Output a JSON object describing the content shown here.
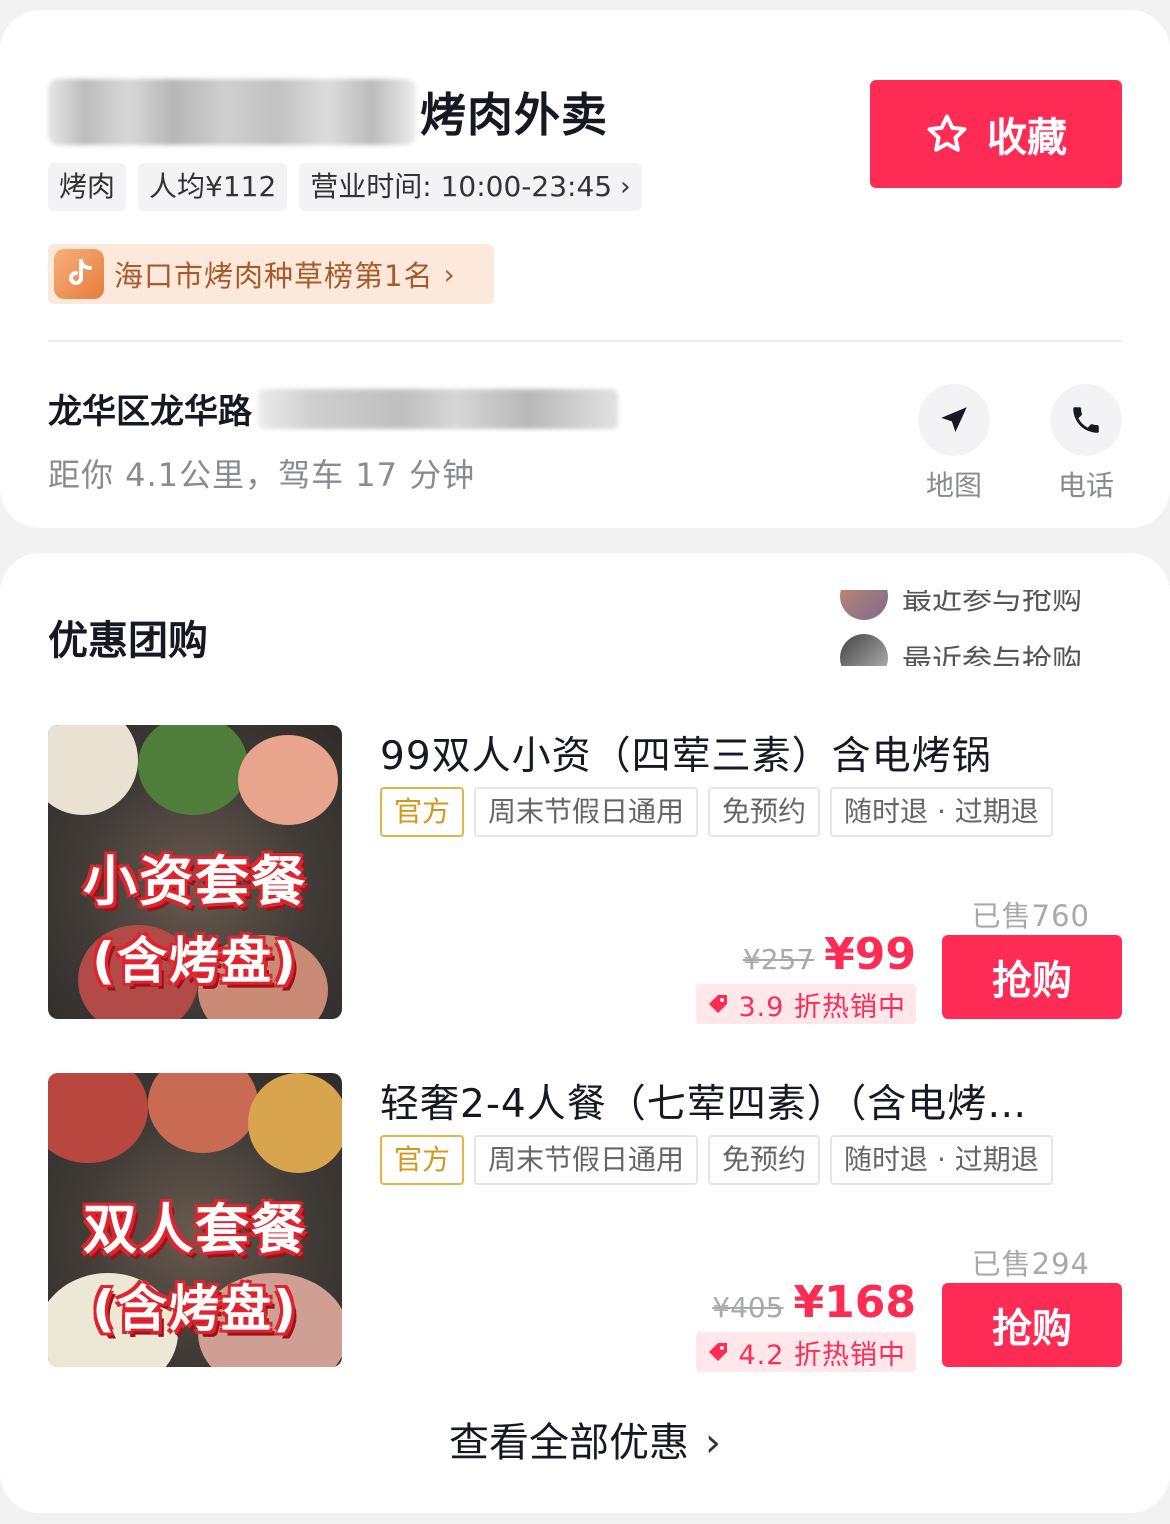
{
  "shop": {
    "title_visible": "烤肉外卖",
    "tags": [
      "烤肉",
      "人均¥112",
      "营业时间: 10:00-23:45"
    ],
    "rank_badge": "海口市烤肉种草榜第1名",
    "favorite_label": "收藏",
    "address": "龙华区龙华路",
    "distance": "距你 4.1公里，驾车 17 分钟",
    "map_label": "地图",
    "phone_label": "电话"
  },
  "deals_section": {
    "title": "优惠团购",
    "ticker": [
      "最近参与抢购",
      "最近参与抢购"
    ],
    "view_all": "查看全部优惠",
    "items": [
      {
        "name": "99双人小资（四荤三素）含电烤锅",
        "tags": [
          "官方",
          "周末节假日通用",
          "免预约",
          "随时退 · 过期退"
        ],
        "sold": "已售760",
        "orig_price": "¥257",
        "price": "¥99",
        "discount": "3.9 折热销中",
        "buy_label": "抢购",
        "image_line1": "小资套餐",
        "image_line2": "(含烤盘)"
      },
      {
        "name": "轻奢2-4人餐（七荤四素）（含电烤…",
        "tags": [
          "官方",
          "周末节假日通用",
          "免预约",
          "随时退 · 过期退"
        ],
        "sold": "已售294",
        "orig_price": "¥405",
        "price": "¥168",
        "discount": "4.2 折热销中",
        "buy_label": "抢购",
        "image_line1": "双人套餐",
        "image_line2": "(含烤盘)"
      }
    ]
  },
  "colors": {
    "accent": "#fe2c55",
    "official": "#d19a1e",
    "rank_bg": "#fde9dc"
  }
}
